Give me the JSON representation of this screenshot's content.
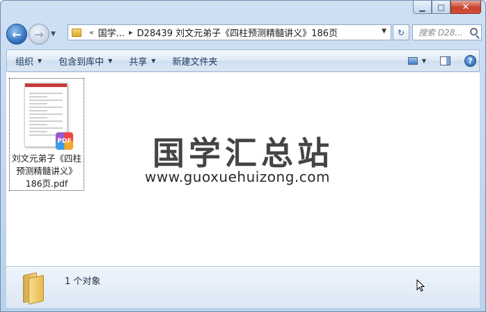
{
  "window": {
    "caption_buttons": {
      "minimize_icon": "minimize-icon",
      "maximize_icon": "maximize-icon",
      "close_icon": "close-icon"
    }
  },
  "navbar": {
    "back_glyph": "←",
    "forward_glyph": "→",
    "history_glyph": "▼",
    "address": {
      "overflow_glyph": "«",
      "crumbs": [
        "国学...",
        "D28439 刘文元弟子《四柱预测精髓讲义》186页"
      ],
      "separator_glyph": "▸",
      "dropdown_glyph": "▼"
    },
    "refresh_glyph": "↻",
    "search": {
      "placeholder": "搜索 D28..."
    }
  },
  "toolbar": {
    "items": [
      {
        "label": "组织",
        "has_arrow": true
      },
      {
        "label": "包含到库中",
        "has_arrow": true
      },
      {
        "label": "共享",
        "has_arrow": true
      },
      {
        "label": "新建文件夹",
        "has_arrow": false
      }
    ],
    "arrow_glyph": "▼",
    "help_glyph": "?"
  },
  "content": {
    "files": [
      {
        "name_lines": [
          "刘文元弟子《四柱",
          "预测精髓讲义》",
          "186页.pdf"
        ],
        "type_badge": "PDF"
      }
    ],
    "watermark": {
      "title": "国学汇总站",
      "url": "www.guoxuehuizong.com"
    }
  },
  "details": {
    "count_text": "1 个对象"
  },
  "colors": {
    "frame": "#b9d1ea",
    "accent": "#2a69b8",
    "close": "#c7412b",
    "pdf_red": "#f2453d"
  }
}
